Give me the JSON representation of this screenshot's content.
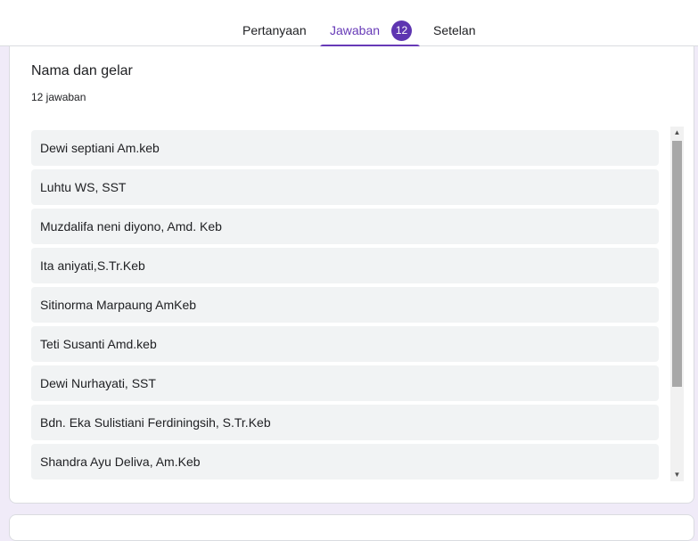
{
  "tabs": {
    "questions_label": "Pertanyaan",
    "responses_label": "Jawaban",
    "responses_count": "12",
    "settings_label": "Setelan"
  },
  "question": {
    "title": "Nama dan gelar",
    "count_label": "12 jawaban"
  },
  "responses": [
    "Dewi septiani Am.keb",
    "Luhtu WS, SST",
    "Muzdalifa neni diyono, Amd. Keb",
    "Ita aniyati,S.Tr.Keb",
    "Sitinorma Marpaung AmKeb",
    "Teti Susanti Amd.keb",
    "Dewi Nurhayati, SST",
    "Bdn. Eka Sulistiani Ferdiningsih, S.Tr.Keb",
    "Shandra Ayu Deliva, Am.Keb"
  ],
  "scroll_position": 0,
  "colors": {
    "accent": "#673ab7",
    "badge": "#5e35b1",
    "background": "#f0ebf8",
    "item_background": "#f1f3f4"
  }
}
